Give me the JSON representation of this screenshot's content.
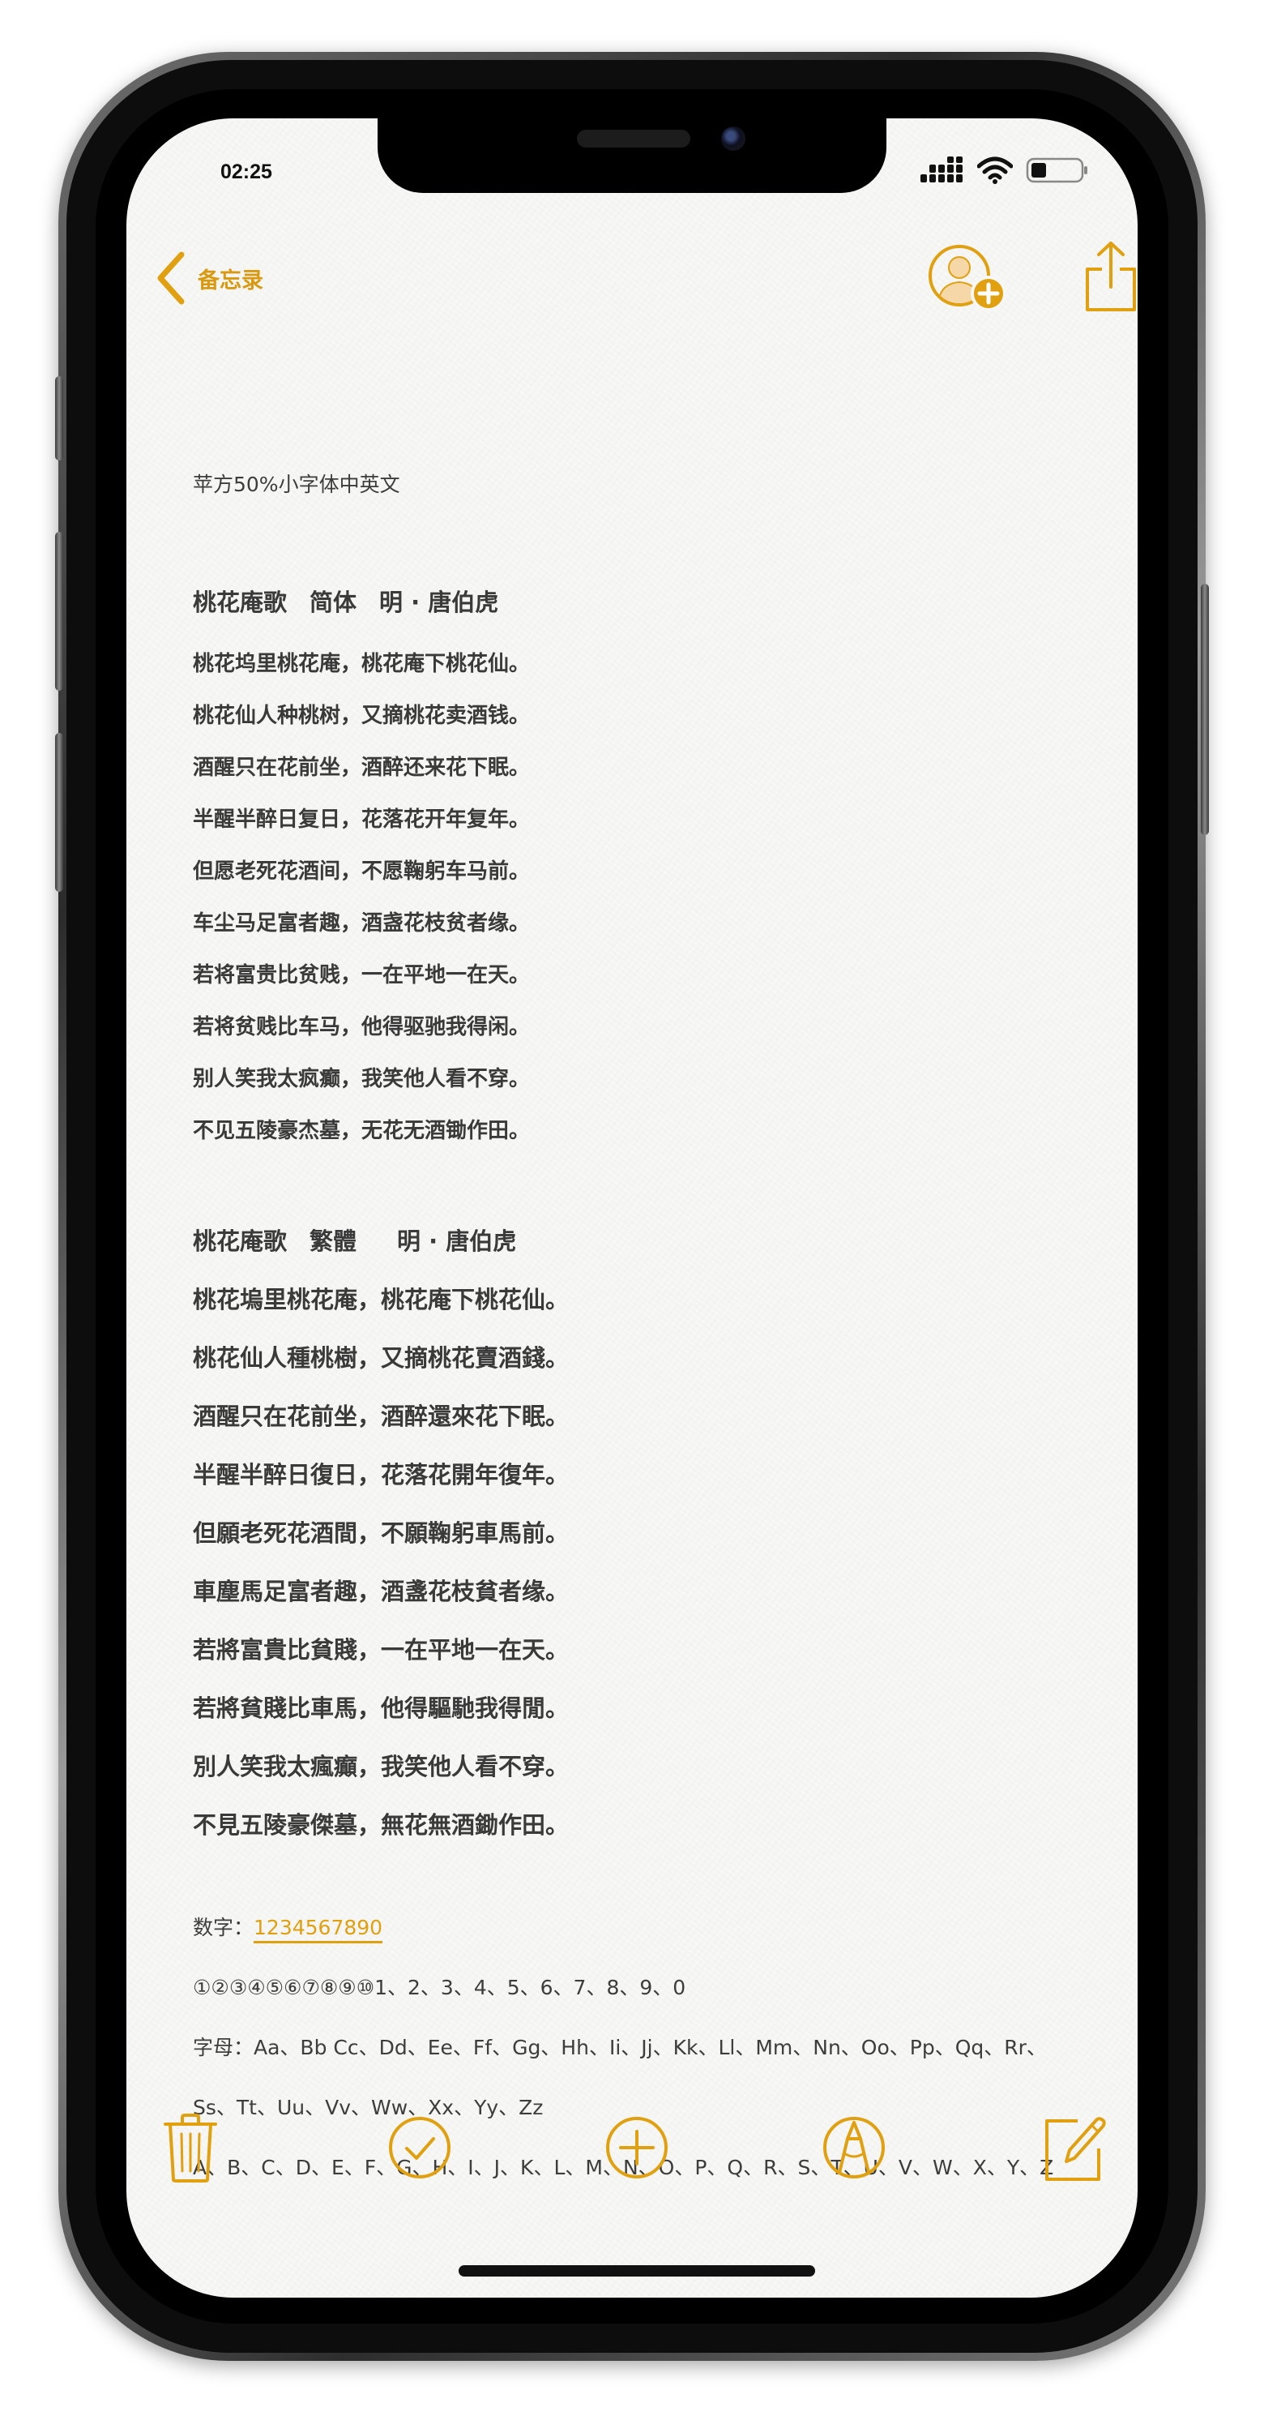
{
  "status_bar": {
    "time": "02:25"
  },
  "nav": {
    "back_label": "备忘录",
    "icons": [
      "chevron-left-icon",
      "add-person-icon",
      "share-icon"
    ]
  },
  "note": {
    "subtitle": "苹方50%小字体中英文",
    "simplified": {
      "title_parts": [
        "桃花庵歌",
        "简体",
        "明 · 唐伯虎"
      ],
      "lines": [
        "桃花坞里桃花庵，桃花庵下桃花仙。",
        "桃花仙人种桃树，又摘桃花卖酒钱。",
        "酒醒只在花前坐，酒醉还来花下眠。",
        "半醒半醉日复日，花落花开年复年。",
        "但愿老死花酒间，不愿鞠躬车马前。",
        "车尘马足富者趣，酒盏花枝贫者缘。",
        "若将富贵比贫贱，一在平地一在天。",
        "若将贫贱比车马，他得驱驰我得闲。",
        "别人笑我太疯癫，我笑他人看不穿。",
        "不见五陵豪杰墓，无花无酒锄作田。"
      ]
    },
    "traditional": {
      "title_parts": [
        "桃花庵歌",
        "繁體",
        "明 · 唐伯虎"
      ],
      "lines": [
        "桃花塢里桃花庵，桃花庵下桃花仙。",
        "桃花仙人種桃樹，又摘桃花賣酒錢。",
        "酒醒只在花前坐，酒醉還來花下眠。",
        "半醒半醉日復日，花落花開年復年。",
        "但願老死花酒間，不願鞠躬車馬前。",
        "車塵馬足富者趣，酒盞花枝貧者缘。",
        "若將富貴比貧賤，一在平地一在天。",
        "若將貧賤比車馬，他得驅馳我得閒。",
        "別人笑我太瘋癲，我笑他人看不穿。",
        "不見五陵豪傑墓，無花無酒鋤作田。"
      ]
    },
    "numbers_label": "数字：",
    "numbers_link": "1234567890",
    "circled_numbers": "①②③④⑤⑥⑦⑧⑨⑩1、2、3、4、5、6、7、8、9、0",
    "letters_line1": "字母：Aa、Bb Cc、Dd、Ee、Ff、Gg、Hh、Ii、Jj、Kk、Ll、Mm、Nn、Oo、Pp、Qq、Rr、",
    "letters_line2": "Ss、Tt、Uu、Vv、Ww、Xx、Yy、Zz",
    "letters_upper": "A、B、C、D、E、F、G、H、I、J、K、L、M、N、O、P、Q、R、S、T、U、V、W、X、Y、Z"
  },
  "toolbar": {
    "icons": [
      "trash-icon",
      "checklist-icon",
      "add-icon",
      "markup-pen-icon",
      "compose-icon"
    ]
  },
  "colors": {
    "accent": "#E0A010",
    "text": "#3A3A3A",
    "paper": "#F7F7F5"
  }
}
